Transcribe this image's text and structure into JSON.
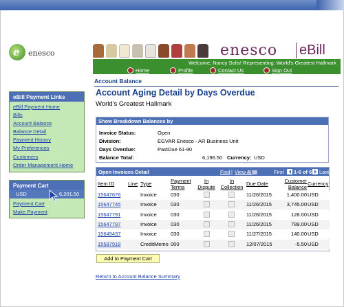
{
  "brand": {
    "left_logo_text": "enesco",
    "right_logo_name": "enesco",
    "right_logo_suffix": "eBill",
    "welcome": "Welcome, Nancy Solis!  Representing: World's Greatest Hallmark",
    "accent_green": "#3b8f2e",
    "accent_blue": "#4d6fb5"
  },
  "nav": {
    "home": "Home",
    "profile": "Profile",
    "contact": "Contact Us",
    "signout": "Sign Out"
  },
  "sidebar": {
    "links_title": "eBill Payment Links",
    "links": [
      "eBill Payment Home",
      "Bills",
      "Account Balance",
      "Balance Detail",
      "Payment History",
      "My Preferences",
      "Customers",
      "Order Management Home"
    ],
    "cart_title": "Payment Cart",
    "cart_currency": "USD",
    "cart_amount": "6,201.50",
    "cart_links": [
      "Payment Cart",
      "Make Payment"
    ]
  },
  "main": {
    "section": "Account Balance",
    "title": "Account Aging Detail by Days Overdue",
    "subtitle": "World's Greatest Hallmark",
    "breakdown": {
      "header": "Show Breakdown Balances by",
      "status_label": "Invoice Status:",
      "status_value": "Open",
      "division_label": "Division:",
      "division_value": "EGVAR Enesco - AR Business Unit",
      "days_label": "Days Overdue:",
      "days_value": "PastDue 61-90",
      "total_label": "Balance Total:",
      "total_value": "6,196.50",
      "currency_label": "Currency:",
      "currency_value": "USD"
    },
    "invoices": {
      "header": "Open Invoices Detail",
      "find": "Find",
      "view_all": "View All",
      "first": "First",
      "range": "1-6 of 6",
      "last": "Last",
      "columns": {
        "item_id": "Item ID",
        "line": "Line",
        "type": "Type",
        "payment_terms": "Payment Terms",
        "in_dispute": "In Dispute",
        "in_collection": "In Collection",
        "due_date": "Due Date",
        "customer_balance": "Customer Balance",
        "currency": "Currency"
      },
      "rows": [
        {
          "id": "15647676",
          "type": "Invoice",
          "terms": "030",
          "due": "11/26/2015",
          "balance": "1,400.00",
          "currency": "USD"
        },
        {
          "id": "15647745",
          "type": "Invoice",
          "terms": "030",
          "due": "11/26/2015",
          "balance": "3,745.00",
          "currency": "USD"
        },
        {
          "id": "15647791",
          "type": "Invoice",
          "terms": "030",
          "due": "11/26/2015",
          "balance": "128.00",
          "currency": "USD"
        },
        {
          "id": "15647797",
          "type": "Invoice",
          "terms": "030",
          "due": "11/26/2015",
          "balance": "789.00",
          "currency": "USD"
        },
        {
          "id": "15649437",
          "type": "Invoice",
          "terms": "030",
          "due": "11/27/2015",
          "balance": "140.00",
          "currency": "USD"
        },
        {
          "id": "15587918",
          "type": "CreditMemo",
          "terms": "000",
          "due": "12/07/2015",
          "balance": "-5.50",
          "currency": "USD"
        }
      ]
    },
    "add_button": "Add to Payment Cart",
    "return_link": "Return to Account Balance Summary"
  }
}
